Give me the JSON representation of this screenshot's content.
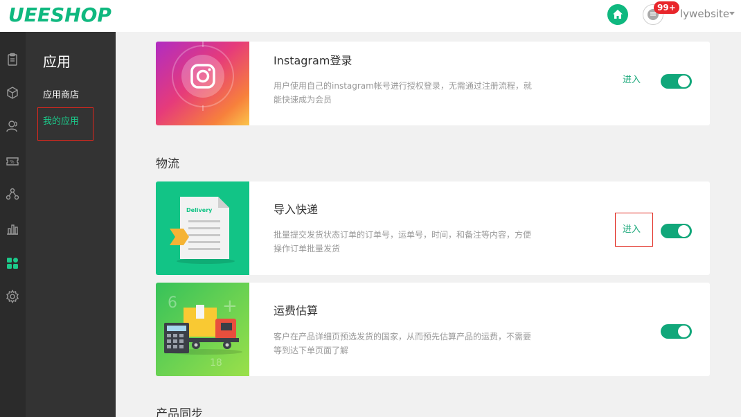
{
  "header": {
    "logo_text": "UEESHOP",
    "home_icon": "home-icon",
    "message_icon": "message-icon",
    "badge": "99+",
    "username": "lywebsite"
  },
  "rail": {
    "items": [
      "orders-icon",
      "products-icon",
      "users-icon",
      "discount-icon",
      "channels-icon",
      "stats-icon",
      "apps-icon",
      "settings-icon"
    ],
    "active": "apps-icon",
    "active_color": "#1cc98a"
  },
  "sidebar": {
    "title": "应用",
    "items": [
      {
        "label": "应用商店"
      },
      {
        "label": "我的应用"
      }
    ]
  },
  "main": {
    "apps": [
      {
        "title": "Instagram登录",
        "desc": "用户使用自己的instagram帐号进行授权登录，无需通过注册流程，就能快速成为会员",
        "enter": "进入",
        "enabled": true
      },
      {
        "title": "导入快递",
        "desc": "批量提交发货状态订单的订单号，运单号，时间，和备注等内容，方便操作订单批量发货",
        "enter": "进入",
        "enabled": true,
        "image_text": "Delivery"
      },
      {
        "title": "运费估算",
        "desc": "客户在产品详细页预选发货的国家，从而预先估算产品的运费，不需要等到达下单页面了解",
        "enabled": true
      }
    ],
    "sections": {
      "logistics": "物流",
      "product_sync": "产品同步"
    }
  },
  "colors": {
    "brand": "#0fb87f",
    "toggle_on": "#11a77a",
    "highlight_border": "#e0271d"
  }
}
